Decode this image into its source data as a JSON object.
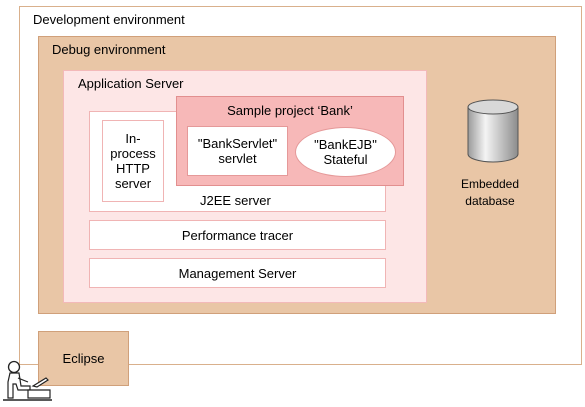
{
  "environments": {
    "development": "Development environment",
    "debug": "Debug environment"
  },
  "application_server": {
    "title": "Application Server",
    "j2ee_label": "J2EE server",
    "http_server": [
      "In-",
      "process",
      "HTTP",
      "server"
    ],
    "sample_project": {
      "title": "Sample project ‘Bank’",
      "servlet": [
        "\"BankServlet\"",
        "servlet"
      ],
      "ejb": [
        "\"BankEJB\"",
        "Stateful"
      ]
    },
    "performance_tracer": "Performance tracer",
    "management_server": "Management Server"
  },
  "database": {
    "label_lines": [
      "Embedded",
      "database"
    ],
    "icon": "database-cylinder-icon"
  },
  "eclipse": "Eclipse",
  "user_icon": "user-at-computer-icon"
}
